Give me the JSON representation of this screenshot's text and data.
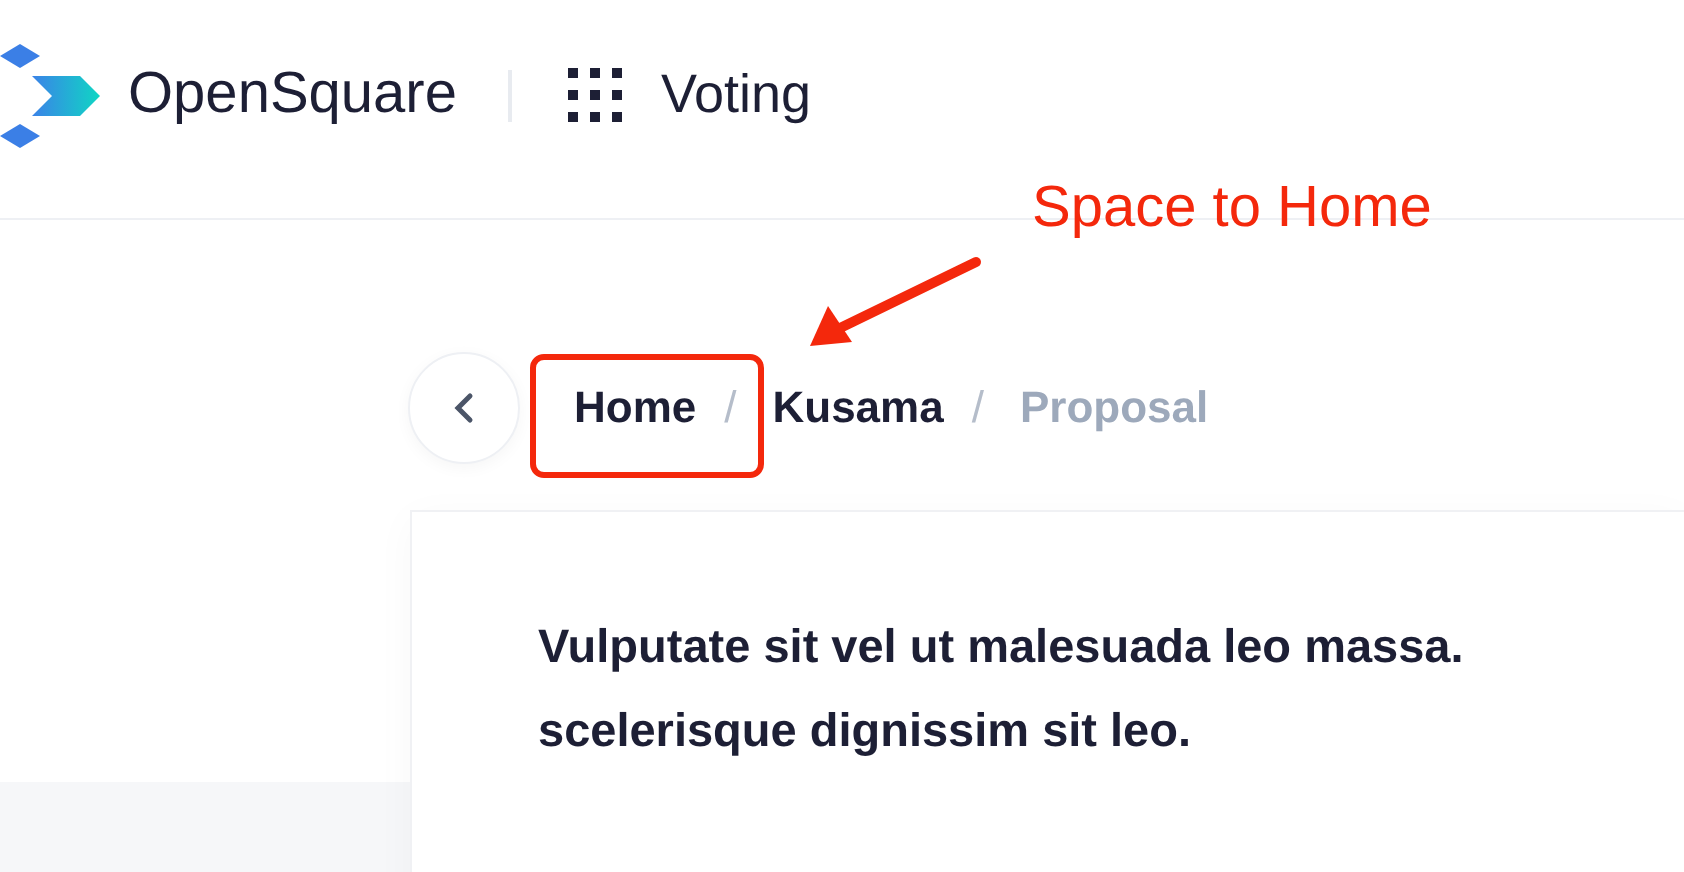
{
  "header": {
    "brand": "OpenSquare",
    "app": "Voting"
  },
  "breadcrumb": [
    {
      "label": "Home",
      "current": false
    },
    {
      "label": "Kusama",
      "current": false
    },
    {
      "label": "Proposal",
      "current": true
    }
  ],
  "breadcrumb_separators": [
    "/",
    "/"
  ],
  "proposal": {
    "title": "Vulputate sit vel ut malesuada leo massa.\nscelerisque dignissim sit leo."
  },
  "annotation": {
    "label": "Space to Home"
  }
}
